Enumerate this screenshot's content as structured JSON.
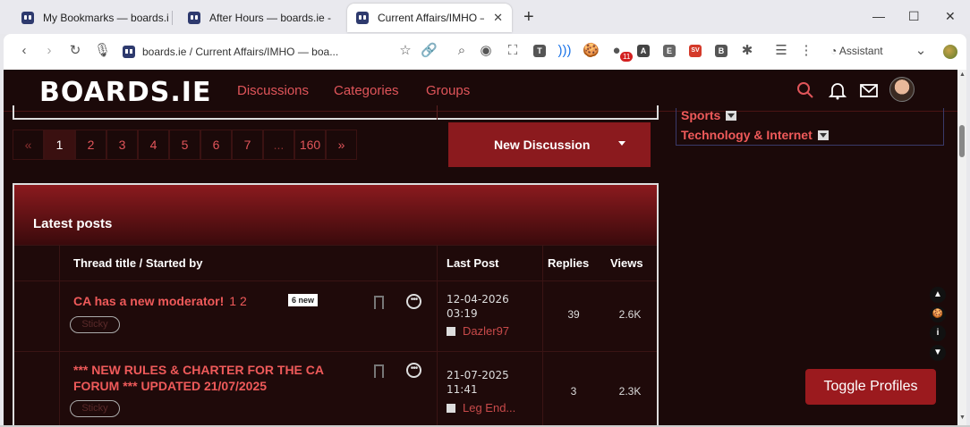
{
  "tabs": [
    {
      "title": "My Bookmarks — boards.ie",
      "active": false
    },
    {
      "title": "After Hours — boards.ie - ...",
      "active": false
    },
    {
      "title": "Current Affairs/IMHO — boards.ie",
      "active": true
    }
  ],
  "window": {
    "minimize": "—",
    "maximize": "☐",
    "close": "✕"
  },
  "toolbar": {
    "address": "boards.ie / Current Affairs/IMHO — boa...",
    "badge_count": "11",
    "assistant_label": "Assistant",
    "extensions": [
      "T",
      "A",
      "E",
      "SV",
      "B"
    ]
  },
  "site": {
    "logo": "BOARDS.IE",
    "nav": [
      "Discussions",
      "Categories",
      "Groups"
    ]
  },
  "pagination": {
    "prev": "«",
    "pages": [
      "1",
      "2",
      "3",
      "4",
      "5",
      "6",
      "7",
      "...",
      "160"
    ],
    "next": "»",
    "current": "1"
  },
  "new_discussion_label": "New Discussion",
  "latest": {
    "heading": "Latest posts",
    "columns": {
      "title": "Thread title / Started by",
      "last_post": "Last Post",
      "replies": "Replies",
      "views": "Views"
    },
    "rows": [
      {
        "title": "CA has a new moderator!",
        "pages": "1 2",
        "new_badge": "6 new",
        "tag": "Sticky",
        "date": "12-04-2026",
        "time": "03:19",
        "user": "Dazler97",
        "replies": "39",
        "views": "2.6K"
      },
      {
        "title_line1": "*** NEW RULES & CHARTER FOR THE CA",
        "title_line2": "FORUM *** UPDATED 21/07/2025",
        "tag": "Sticky",
        "date": "21-07-2025",
        "time": "11:41",
        "user": "Leg End...",
        "replies": "3",
        "views": "2.3K"
      }
    ]
  },
  "sidebar": {
    "categories": [
      "Sports",
      "Technology & Internet"
    ]
  },
  "float_controls": [
    "▲",
    "🍪",
    "i",
    "▼"
  ],
  "toggle_profiles_label": "Toggle Profiles",
  "colors": {
    "accent": "#e0555a",
    "bg": "#1b0909",
    "button": "#8b1a1e"
  }
}
